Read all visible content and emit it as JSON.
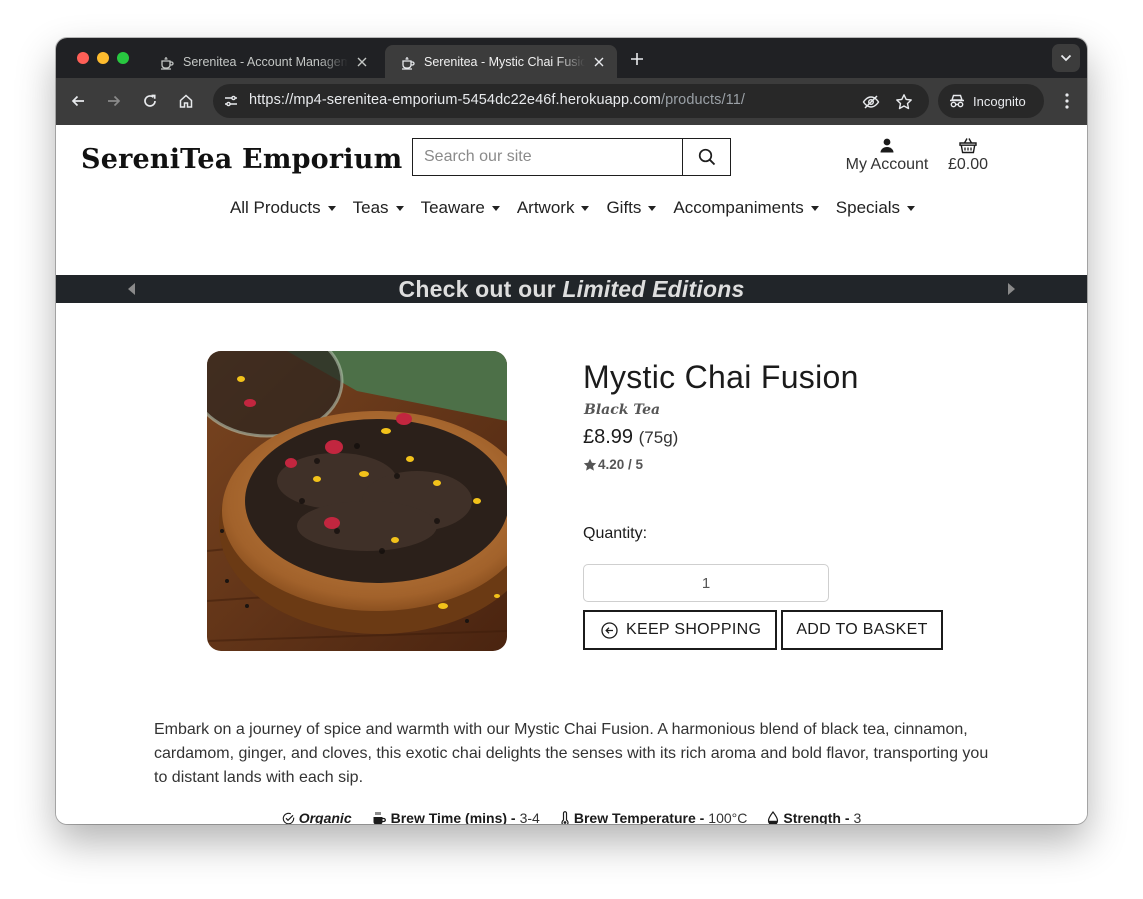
{
  "browser": {
    "tabs": [
      {
        "title": "Serenitea - Account Management",
        "active": false
      },
      {
        "title": "Serenitea - Mystic Chai Fusion",
        "active": true
      }
    ],
    "url_host": "https://mp4-serenitea-emporium-5454dc22e46f.herokuapp.com",
    "url_path": "/products/11/",
    "incognito_label": "Incognito"
  },
  "header": {
    "brand": "SereniTea Emporium",
    "search_placeholder": "Search our site",
    "account_label": "My Account",
    "basket_total": "£0.00"
  },
  "nav": {
    "items": [
      "All Products",
      "Teas",
      "Teaware",
      "Artwork",
      "Gifts",
      "Accompaniments",
      "Specials"
    ]
  },
  "banner": {
    "prefix": "Check out our",
    "emphasis": "Limited Editions"
  },
  "product": {
    "name": "Mystic Chai Fusion",
    "category": "Black Tea",
    "price": "£8.99",
    "weight": "(75g)",
    "rating": "4.20 / 5",
    "quantity_label": "Quantity:",
    "quantity_value": "1",
    "keep_shopping_label": "KEEP SHOPPING",
    "add_to_basket_label": "ADD TO BASKET",
    "description": "Embark on a journey of spice and warmth with our Mystic Chai Fusion. A harmonious blend of black tea, cinnamon, cardamom, ginger, and cloves, this exotic chai delights the senses with its rich aroma and bold flavor, transporting you to distant lands with each sip.",
    "attributes": {
      "organic": "Organic",
      "brew_time_label": "Brew Time (mins) -",
      "brew_time_value": "3-4",
      "brew_temp_label": "Brew Temperature -",
      "brew_temp_value": "100°C",
      "strength_label": "Strength -",
      "strength_value": "3"
    }
  },
  "icons": {
    "favicon": "teapot-icon",
    "search": "search-icon",
    "account": "user-icon",
    "basket": "basket-icon",
    "rating": "star-icon",
    "keep_shopping": "circle-arrow-left-icon",
    "organic": "check-circle-icon",
    "brew_time": "mug-icon",
    "brew_temp": "thermometer-icon",
    "strength": "droplet-icon"
  },
  "colors": {
    "banner_bg": "#212529",
    "chrome_dark": "#202124",
    "toolbar": "#3c3c3c"
  }
}
